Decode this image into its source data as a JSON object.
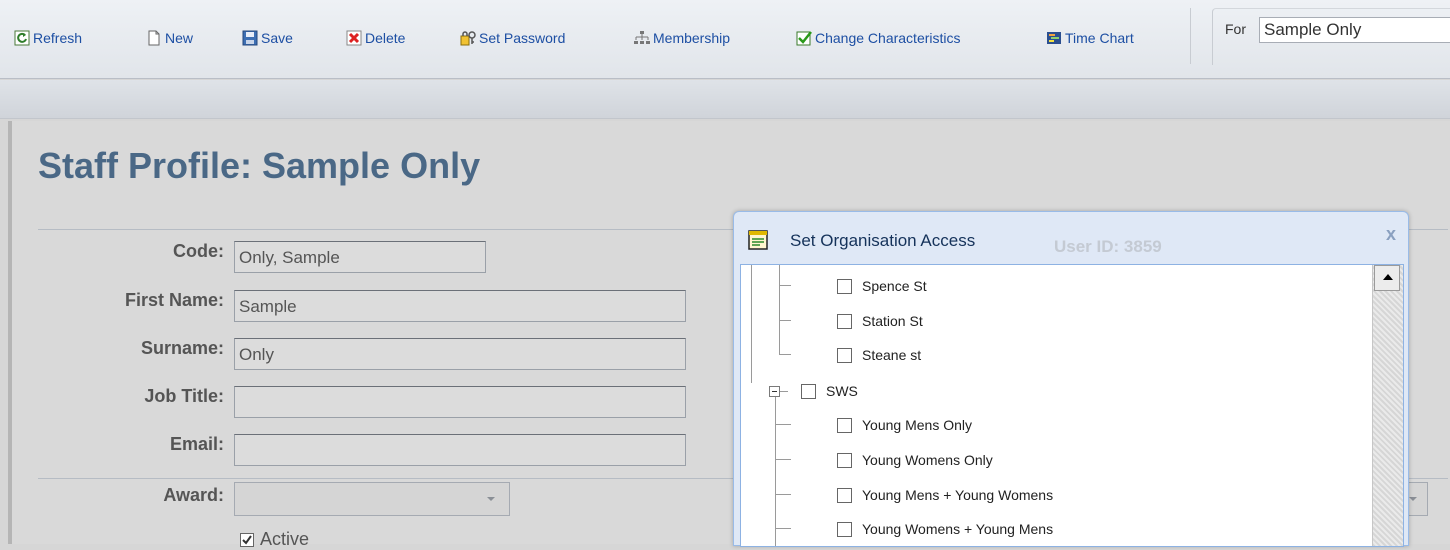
{
  "toolbar": {
    "buttons": [
      {
        "label": "Refresh",
        "icon": "refresh-icon"
      },
      {
        "label": "New",
        "icon": "new-document-icon"
      },
      {
        "label": "Save",
        "icon": "save-disk-icon"
      },
      {
        "label": "Delete",
        "icon": "delete-icon"
      },
      {
        "label": "Set Password",
        "icon": "key-lock-icon"
      },
      {
        "label": "Membership",
        "icon": "hierarchy-icon"
      },
      {
        "label": "Change Characteristics",
        "icon": "checkmark-icon"
      },
      {
        "label": "Time Chart",
        "icon": "time-chart-icon"
      }
    ],
    "for_label": "For",
    "for_value": "Sample Only"
  },
  "page": {
    "title": "Staff Profile: Sample Only"
  },
  "form": {
    "fields": [
      {
        "label": "Code:",
        "value": "Only, Sample"
      },
      {
        "label": "First Name:",
        "value": "Sample"
      },
      {
        "label": "Surname:",
        "value": "Only"
      },
      {
        "label": "Job Title:",
        "value": ""
      },
      {
        "label": "Email:",
        "value": ""
      }
    ],
    "award_label": "Award:",
    "award_value": "",
    "active_label": "Active",
    "active_checked": true
  },
  "dialog": {
    "title": "Set Organisation Access",
    "ghost_text": "User ID: 3859",
    "close_label": "x",
    "tree": [
      {
        "label": "Spence St",
        "checked": false
      },
      {
        "label": "Station St",
        "checked": false
      },
      {
        "label": "Steane st",
        "checked": false
      },
      {
        "label": "SWS",
        "checked": false,
        "expanded": true
      },
      {
        "label": "Young Mens Only",
        "checked": false
      },
      {
        "label": "Young Womens Only",
        "checked": false
      },
      {
        "label": "Young Mens + Young Womens",
        "checked": false
      },
      {
        "label": "Young Womens + Young Mens",
        "checked": false
      }
    ]
  },
  "colors": {
    "link_blue": "#1d4fa3",
    "title_blue": "#4a6886",
    "dialog_border": "#99bbe8"
  }
}
